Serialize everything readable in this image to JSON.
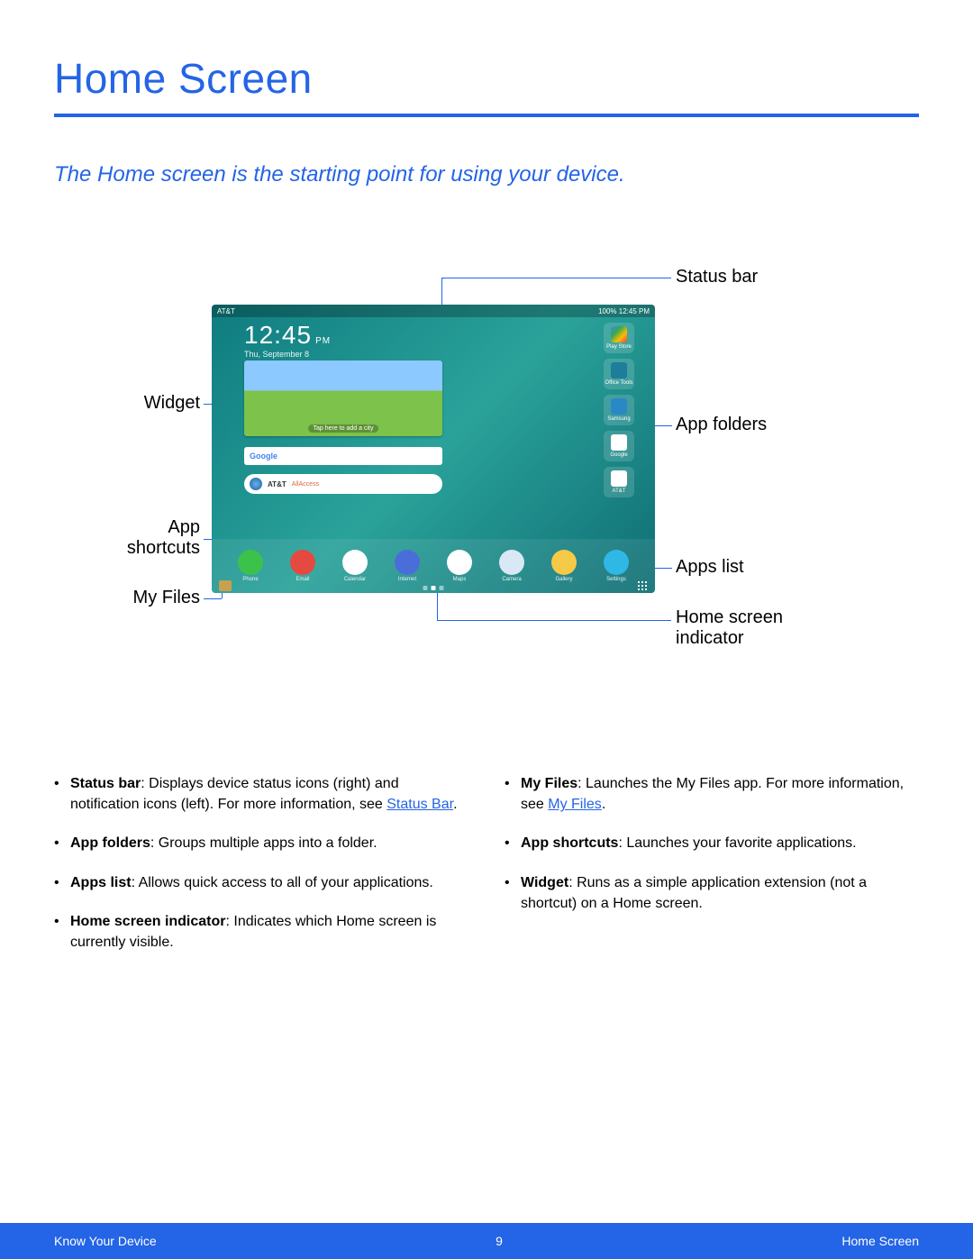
{
  "page": {
    "title": "Home Screen",
    "subtitle": "The Home screen is the starting point for using your device."
  },
  "callouts": {
    "status_bar": "Status bar",
    "widget": "Widget",
    "app_folders": "App folders",
    "app_shortcuts": "App\nshortcuts",
    "my_files": "My Files",
    "apps_list": "Apps list",
    "home_indicator": "Home screen\nindicator"
  },
  "tablet": {
    "status_left": "AT&T",
    "status_right": "100%  12:45 PM",
    "clock_time": "12:45",
    "clock_ampm": "PM",
    "clock_date": "Thu, September 8",
    "widget_hint": "Tap here to add a city",
    "search_brand": "Google",
    "att_label": "AT&T",
    "att_sub": "AllAccess",
    "right_icons": [
      {
        "label": "Play Store"
      },
      {
        "label": "Office Tools"
      },
      {
        "label": "Samsung"
      },
      {
        "label": "Google"
      },
      {
        "label": "AT&T"
      }
    ],
    "dock": [
      {
        "label": "Phone"
      },
      {
        "label": "Email"
      },
      {
        "label": "Calendar"
      },
      {
        "label": "Internet"
      },
      {
        "label": "Maps"
      },
      {
        "label": "Camera"
      },
      {
        "label": "Gallery"
      },
      {
        "label": "Settings"
      }
    ]
  },
  "bullets": {
    "left": [
      {
        "term": "Status bar",
        "text": ": Displays device status icons (right) and notification icons (left). For more information, see ",
        "link": "Status Bar",
        "tail": "."
      },
      {
        "term": "App folders",
        "text": ": Groups multiple apps into a folder."
      },
      {
        "term": "Apps list",
        "text": ": Allows quick access to all of your applications."
      },
      {
        "term": "Home screen indicator",
        "text": ": Indicates which Home screen is currently visible."
      }
    ],
    "right": [
      {
        "term": "My Files",
        "text": ": Launches the My Files app. For more information, see ",
        "link": "My Files",
        "tail": "."
      },
      {
        "term": "App shortcuts",
        "text": ": Launches your favorite applications."
      },
      {
        "term": "Widget",
        "text": ": Runs as a simple application extension (not a shortcut) on a Home screen."
      }
    ]
  },
  "footer": {
    "left": "Know Your Device",
    "center": "9",
    "right": "Home Screen"
  }
}
